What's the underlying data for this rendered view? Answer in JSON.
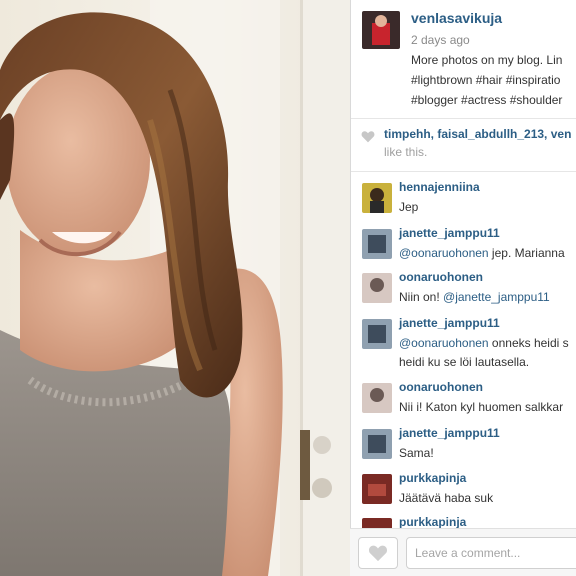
{
  "post": {
    "username": "venlasavikuja",
    "time": "2 days ago",
    "caption_lines": [
      "More photos on my blog. Lin",
      "#lightbrown #hair #inspiratio",
      "#blogger #actress #shoulder"
    ],
    "likes": {
      "names": "timpehh, faisal_abdullh_213, ven",
      "suffix": "like this."
    }
  },
  "comments": [
    {
      "user": "hennajenniina",
      "lines": [
        [
          "Jep"
        ]
      ]
    },
    {
      "user": "janette_jamppu11",
      "lines": [
        [
          "@oonaruohonen",
          " jep. Marianna"
        ]
      ]
    },
    {
      "user": "oonaruohonen",
      "lines": [
        [
          "Niin on! ",
          "@janette_jamppu11"
        ]
      ]
    },
    {
      "user": "janette_jamppu11",
      "lines": [
        [
          "@oonaruohonen",
          " onneks heidi s"
        ],
        [
          "heidi ku se löi lautasella."
        ]
      ]
    },
    {
      "user": "oonaruohonen",
      "lines": [
        [
          "Nii i! Katon kyl huomen salkkar"
        ]
      ]
    },
    {
      "user": "janette_jamppu11",
      "lines": [
        [
          "Sama!"
        ]
      ]
    },
    {
      "user": "purkkapinja",
      "lines": [
        [
          "Jäätävä haba suk"
        ]
      ]
    },
    {
      "user": "purkkapinja",
      "lines": []
    }
  ],
  "footer": {
    "comment_placeholder": "Leave a comment..."
  },
  "icons": {
    "like": "heart-icon",
    "liked_by": "heart-icon"
  },
  "colors": {
    "link": "#2c5e85",
    "muted": "#8a8a8a"
  }
}
